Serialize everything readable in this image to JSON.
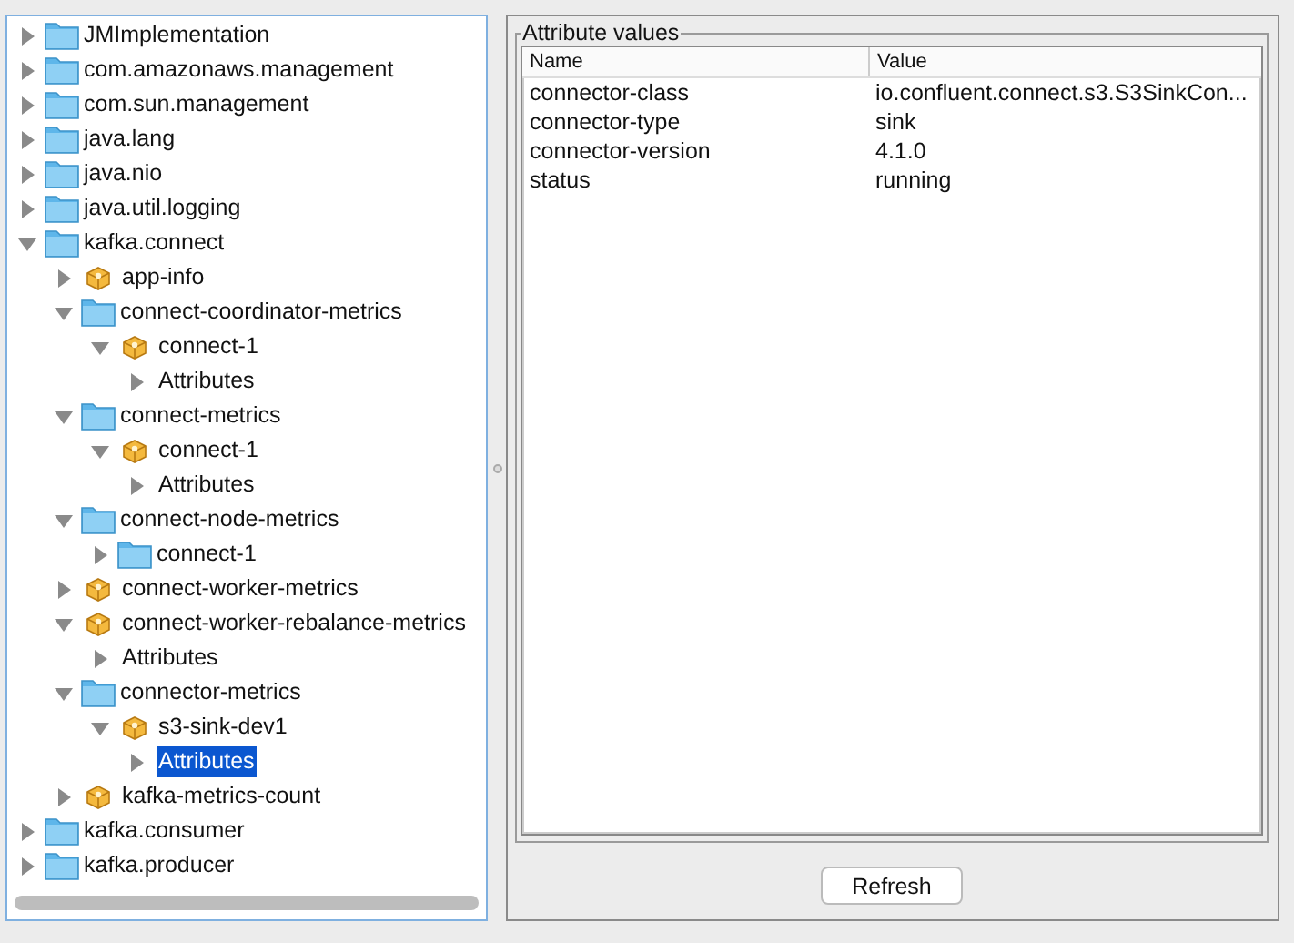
{
  "tree": [
    {
      "label": "JMImplementation",
      "kind": "folder",
      "expanded": false,
      "selected": false
    },
    {
      "label": "com.amazonaws.management",
      "kind": "folder",
      "expanded": false,
      "selected": false
    },
    {
      "label": "com.sun.management",
      "kind": "folder",
      "expanded": false,
      "selected": false
    },
    {
      "label": "java.lang",
      "kind": "folder",
      "expanded": false,
      "selected": false
    },
    {
      "label": "java.nio",
      "kind": "folder",
      "expanded": false,
      "selected": false
    },
    {
      "label": "java.util.logging",
      "kind": "folder",
      "expanded": false,
      "selected": false
    },
    {
      "label": "kafka.connect",
      "kind": "folder",
      "expanded": true,
      "selected": false,
      "children": [
        {
          "label": "app-info",
          "kind": "mbean",
          "expanded": false,
          "selected": false
        },
        {
          "label": "connect-coordinator-metrics",
          "kind": "folder",
          "expanded": true,
          "selected": false,
          "children": [
            {
              "label": "connect-1",
              "kind": "mbean",
              "expanded": true,
              "selected": false,
              "children": [
                {
                  "label": "Attributes",
                  "kind": "attributes",
                  "expanded": false,
                  "selected": false
                }
              ]
            }
          ]
        },
        {
          "label": "connect-metrics",
          "kind": "folder",
          "expanded": true,
          "selected": false,
          "children": [
            {
              "label": "connect-1",
              "kind": "mbean",
              "expanded": true,
              "selected": false,
              "children": [
                {
                  "label": "Attributes",
                  "kind": "attributes",
                  "expanded": false,
                  "selected": false
                }
              ]
            }
          ]
        },
        {
          "label": "connect-node-metrics",
          "kind": "folder",
          "expanded": true,
          "selected": false,
          "children": [
            {
              "label": "connect-1",
              "kind": "folder",
              "expanded": false,
              "selected": false
            }
          ]
        },
        {
          "label": "connect-worker-metrics",
          "kind": "mbean",
          "expanded": false,
          "selected": false
        },
        {
          "label": "connect-worker-rebalance-metrics",
          "kind": "mbean",
          "expanded": true,
          "selected": false,
          "children": [
            {
              "label": "Attributes",
              "kind": "attributes",
              "expanded": false,
              "selected": false
            }
          ]
        },
        {
          "label": "connector-metrics",
          "kind": "folder",
          "expanded": true,
          "selected": false,
          "children": [
            {
              "label": "s3-sink-dev1",
              "kind": "mbean",
              "expanded": true,
              "selected": false,
              "children": [
                {
                  "label": "Attributes",
                  "kind": "attributes",
                  "expanded": false,
                  "selected": true
                }
              ]
            }
          ]
        },
        {
          "label": "kafka-metrics-count",
          "kind": "mbean",
          "expanded": false,
          "selected": false
        }
      ]
    },
    {
      "label": "kafka.consumer",
      "kind": "folder",
      "expanded": false,
      "selected": false
    },
    {
      "label": "kafka.producer",
      "kind": "folder",
      "expanded": false,
      "selected": false
    }
  ],
  "attributes": {
    "title": "Attribute values",
    "columns": [
      "Name",
      "Value"
    ],
    "rows": [
      [
        "connector-class",
        "io.confluent.connect.s3.S3SinkCon..."
      ],
      [
        "connector-type",
        "sink"
      ],
      [
        "connector-version",
        "4.1.0"
      ],
      [
        "status",
        "running"
      ]
    ]
  },
  "refresh_button": "Refresh"
}
